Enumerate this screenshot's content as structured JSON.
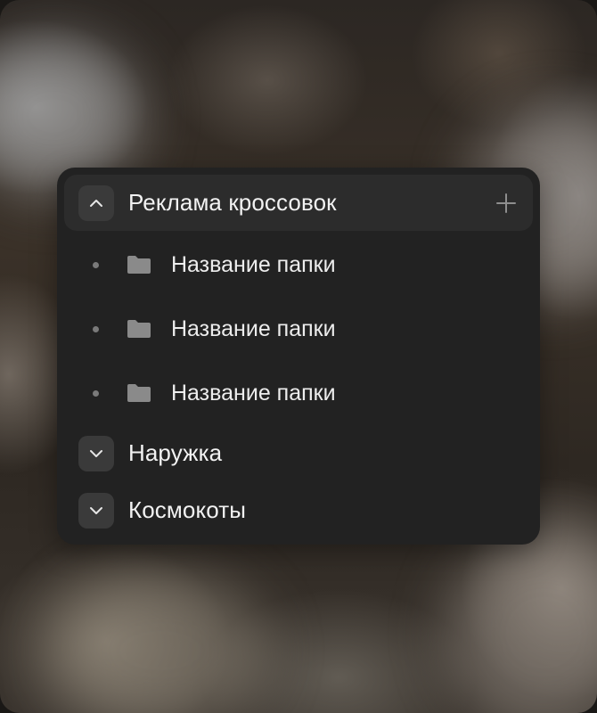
{
  "groups": [
    {
      "title": "Реклама кроссовок",
      "expanded": true,
      "folders": [
        {
          "label": "Название папки"
        },
        {
          "label": "Название папки"
        },
        {
          "label": "Название папки"
        }
      ]
    },
    {
      "title": "Наружка",
      "expanded": false
    },
    {
      "title": "Космокоты",
      "expanded": false
    }
  ],
  "icons": {
    "collapse": "chevron-up-icon",
    "expand": "chevron-down-icon",
    "add": "plus-icon",
    "folder": "folder-icon"
  },
  "colors": {
    "panel_bg": "#222222",
    "active_header_bg": "#2c2c2c",
    "toggle_bg": "#3a3a3a",
    "text": "#f2f2f2",
    "muted": "#7a7a7a"
  }
}
